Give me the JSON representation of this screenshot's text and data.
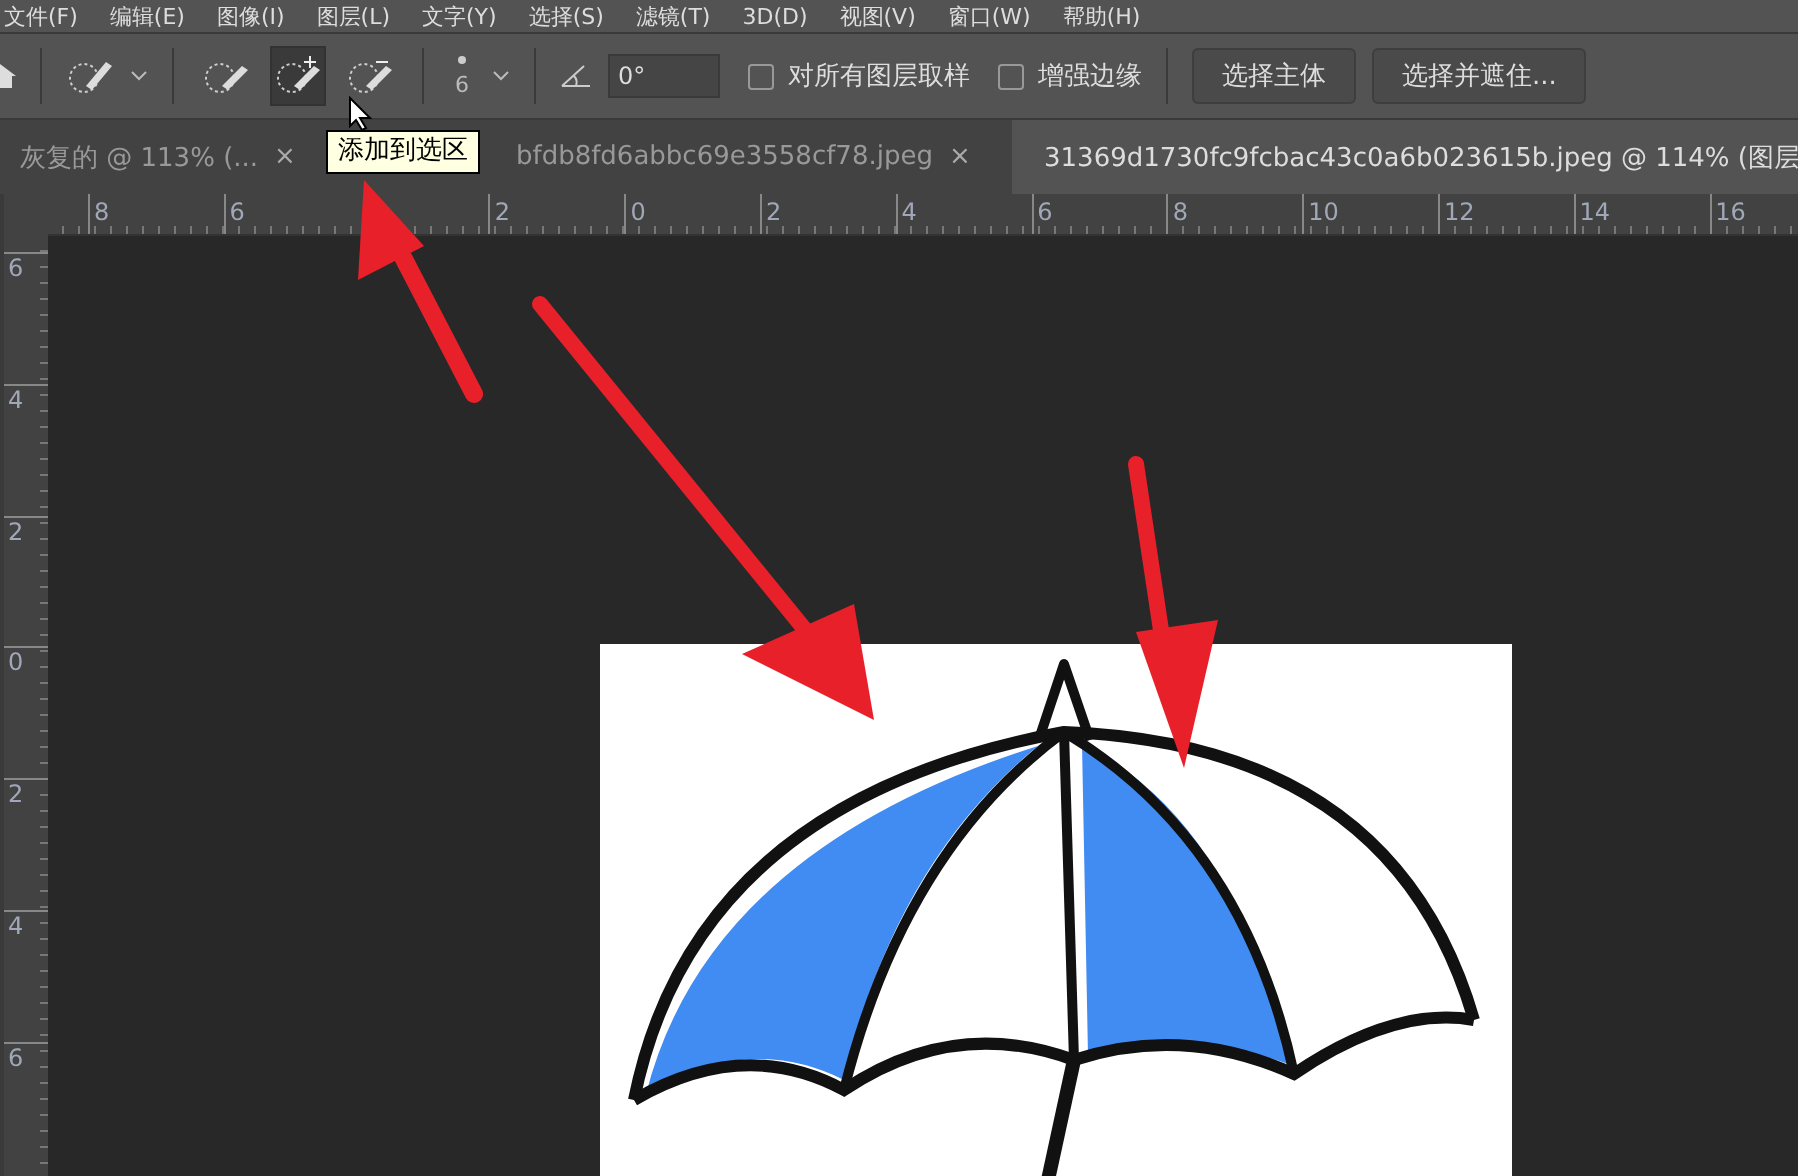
{
  "menu": [
    "文件(F)",
    "编辑(E)",
    "图像(I)",
    "图层(L)",
    "文字(Y)",
    "选择(S)",
    "滤镜(T)",
    "3D(D)",
    "视图(V)",
    "窗口(W)",
    "帮助(H)"
  ],
  "toolbar": {
    "mode_buttons": [
      {
        "kind": "new",
        "selected": false
      },
      {
        "kind": "add",
        "selected": true
      },
      {
        "kind": "subtract",
        "selected": false
      }
    ],
    "brush_size": "6",
    "angle": "0°",
    "checkboxes": [
      {
        "label": "对所有图层取样",
        "checked": false
      },
      {
        "label": "增强边缘",
        "checked": false
      }
    ],
    "buttons": [
      "选择主体",
      "选择并遮住..."
    ]
  },
  "tooltip": "添加到选区",
  "tabs": [
    {
      "title": "灰复的 @ 113% (...",
      "close": "×",
      "selected": false
    },
    {
      "title": "bfdb8fd6abbc69e3558cf78.jpeg",
      "close": "×",
      "selected": false
    },
    {
      "title": "31369d1730fc9fcbac43c0a6b023615b.jpeg @ 114% (图层",
      "selected": true
    }
  ],
  "ruler": {
    "horizontal": [
      "8",
      "6",
      "2",
      "0",
      "2",
      "4",
      "6",
      "8",
      "10",
      "12",
      "14",
      "16"
    ],
    "vertical": [
      "6",
      "4",
      "2",
      "0",
      "2",
      "4",
      "6"
    ]
  }
}
